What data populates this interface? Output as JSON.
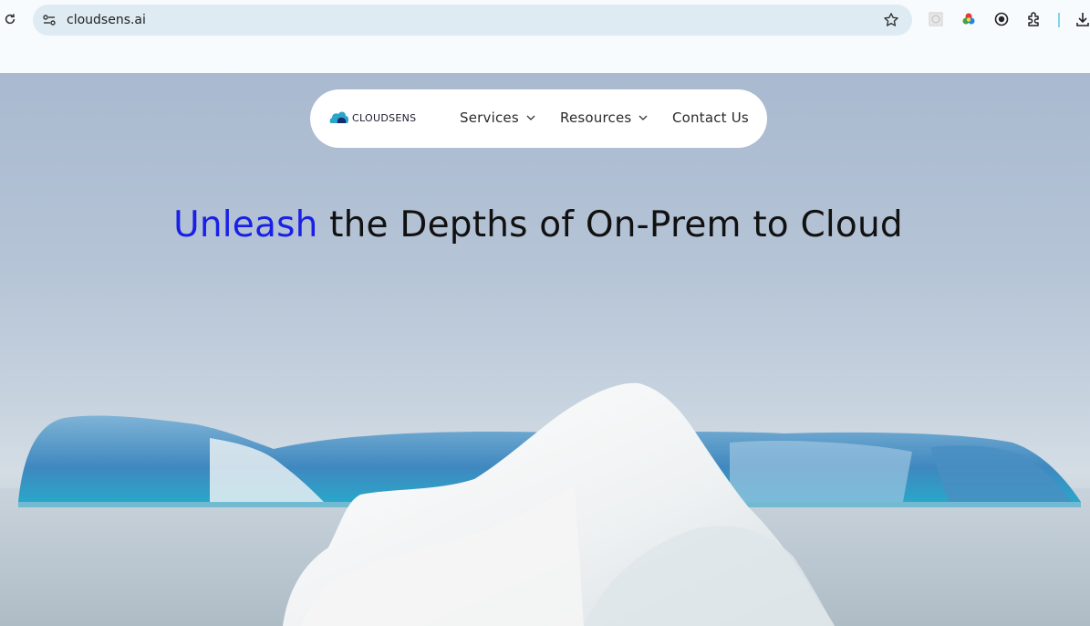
{
  "browser": {
    "url": "cloudsens.ai",
    "icons": [
      "reload-icon",
      "site-info-icon",
      "bookmark-star-icon",
      "extension-grid-icon",
      "color-picker-icon",
      "record-icon",
      "extensions-puzzle-icon",
      "download-icon"
    ]
  },
  "nav": {
    "logo_text": "CLOUDSENS",
    "items": [
      {
        "label": "Services",
        "has_dropdown": true
      },
      {
        "label": "Resources",
        "has_dropdown": true
      },
      {
        "label": "Contact Us",
        "has_dropdown": false
      }
    ]
  },
  "hero": {
    "headline_accent": "Unleash",
    "headline_rest": " the Depths of On-Prem to Cloud",
    "accent_color": "#1a1fe6"
  }
}
